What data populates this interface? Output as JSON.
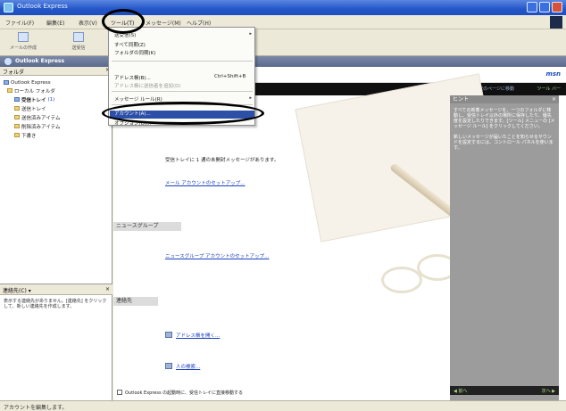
{
  "window": {
    "title": "Outlook Express"
  },
  "menubar": {
    "items": [
      "ファイル(F)",
      "編集(E)",
      "表示(V)",
      "ツール(T)",
      "メッセージ(M)",
      "ヘルプ(H)"
    ]
  },
  "toolbar": {
    "buttons": [
      {
        "label": "メールの作成"
      },
      {
        "label": "送受信"
      }
    ]
  },
  "outlook_bar": {
    "label": "Outlook Express"
  },
  "folders": {
    "header": "フォルダ",
    "items": [
      {
        "label": "Outlook Express"
      },
      {
        "label": "ローカル フォルダ"
      },
      {
        "label": "受信トレイ",
        "count": "(1)"
      },
      {
        "label": "送信トレイ"
      },
      {
        "label": "送信済みアイテム"
      },
      {
        "label": "削除済みアイテム"
      },
      {
        "label": "下書き"
      }
    ]
  },
  "contacts": {
    "header": "連絡先(C) ▾",
    "message": "表示する連絡先がありません。[連絡先] をクリックして、新しい連絡先を作成します。"
  },
  "main": {
    "brand": "msn",
    "goto_label": "次のページに移動",
    "goto_right": "ツール バー",
    "mail_text": "受信トレイに 1 通の未開封メッセージがあります。",
    "mail_link": "メール アカウントのセットアップ...",
    "news_section": "ニュースグループ",
    "news_link": "ニュースグループ アカウントのセットアップ...",
    "contacts_section": "連絡先",
    "addressbook_link": "アドレス帳を開く...",
    "find_link": "人の検索...",
    "startup_check": "Outlook Express の起動時に、受信トレイに直接移動する"
  },
  "tips": {
    "header": "ヒント",
    "body1": "すべての新着メッセージを、一つのフォルダに移動し、受信トレイ以外の場所に保存したり、優先度を設定したりできます。[ツール] メニューの [メッセージ ルール] をクリックしてください。",
    "body2": "新しいメッセージが届いたことを知らせるサウンドを設定するには、コントロール パネルを使います。",
    "prev": "◀ 前へ",
    "next": "次へ ▶"
  },
  "dropdown": {
    "items": [
      {
        "label": "送受信(S)",
        "shortcut": "",
        "arrow": "▸"
      },
      {
        "label": "すべて同期(Z)",
        "shortcut": ""
      },
      {
        "label": "フォルダの同期(K)",
        "shortcut": ""
      },
      {
        "label": "アドレス帳(B)...",
        "shortcut": "Ctrl+Shift+B"
      },
      {
        "label": "アドレス帳に送信者を追加(D)",
        "shortcut": ""
      },
      {
        "label": "メッセージ ルール(R)",
        "shortcut": "",
        "arrow": "▸"
      },
      {
        "label": "アカウント(A)...",
        "shortcut": ""
      },
      {
        "label": "オプション(O)...",
        "shortcut": ""
      }
    ]
  },
  "statusbar": {
    "text": "アカウントを編集します。"
  },
  "colors": {
    "titlebar": "#2456c8",
    "menu_highlight": "#2c4fa8",
    "tips_panel": "#9c9c9c",
    "link": "#1a3fc0"
  },
  "annotations": {
    "ellipses": [
      "tools-menu",
      "accounts-item"
    ]
  }
}
